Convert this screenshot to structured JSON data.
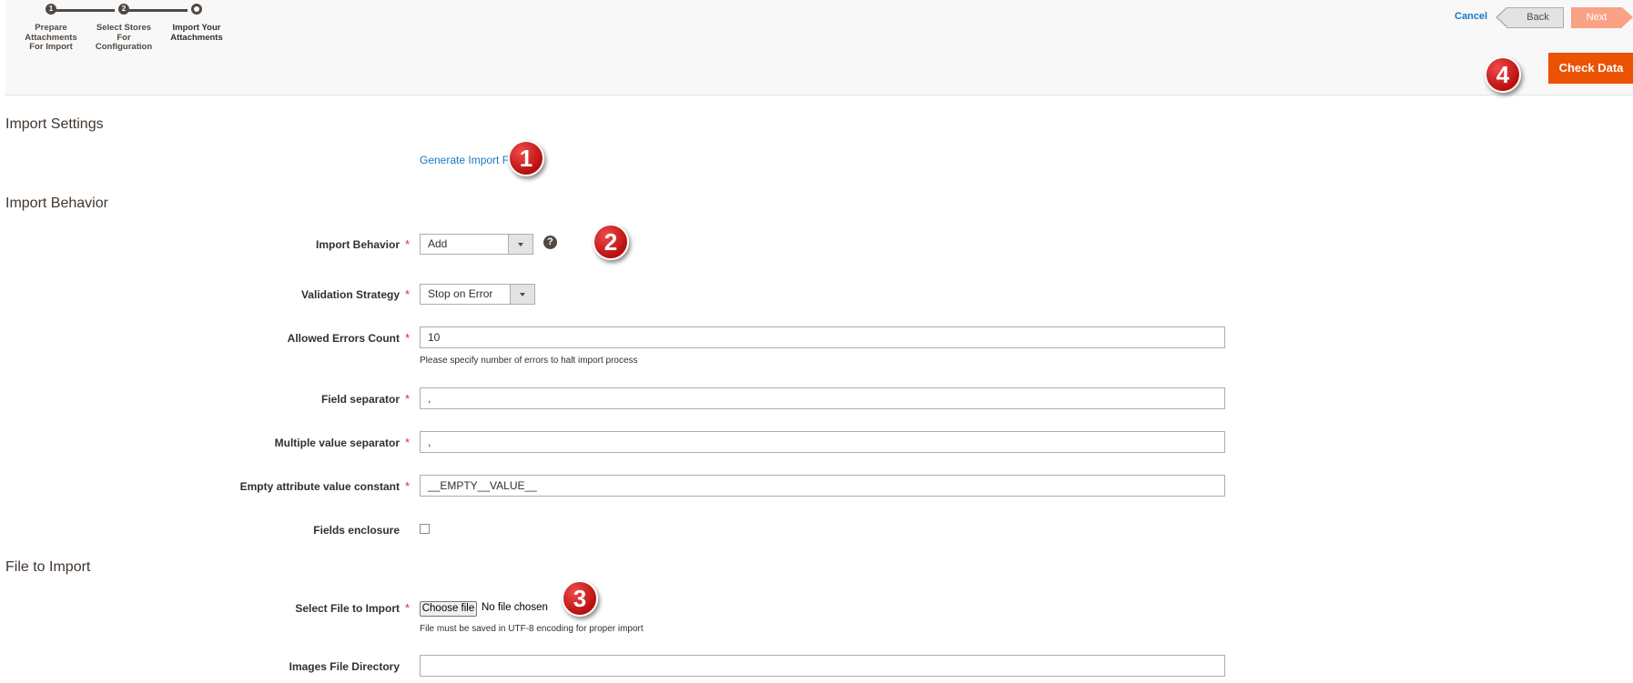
{
  "wizard": {
    "steps": [
      {
        "number": "1",
        "label_lines": [
          "Prepare",
          "Attachments",
          "For Import"
        ]
      },
      {
        "number": "2",
        "label_lines": [
          "Select Stores",
          "For",
          "Configuration"
        ]
      },
      {
        "number": "",
        "label_lines": [
          "Import Your",
          "Attachments"
        ]
      }
    ],
    "cancel_label": "Cancel",
    "back_label": "Back",
    "next_label": "Next",
    "check_data_label": "Check Data"
  },
  "badges": [
    "1",
    "2",
    "3",
    "4"
  ],
  "sections": {
    "import_settings": "Import Settings",
    "import_behavior": "Import Behavior",
    "file_to_import": "File to Import"
  },
  "generate_link": "Generate Import File",
  "form": {
    "import_behavior": {
      "label": "Import Behavior",
      "value": "Add"
    },
    "validation_strategy": {
      "label": "Validation Strategy",
      "value": "Stop on Error"
    },
    "allowed_errors": {
      "label": "Allowed Errors Count",
      "value": "10",
      "note": "Please specify number of errors to halt import process"
    },
    "field_separator": {
      "label": "Field separator",
      "value": ","
    },
    "multiple_value_separator": {
      "label": "Multiple value separator",
      "value": ","
    },
    "empty_attribute": {
      "label": "Empty attribute value constant",
      "value": "__EMPTY__VALUE__"
    },
    "fields_enclosure": {
      "label": "Fields enclosure"
    },
    "select_file": {
      "label": "Select File to Import",
      "button": "Choose file",
      "status": "No file chosen",
      "note": "File must be saved in UTF-8 encoding for proper import"
    },
    "images_dir": {
      "label": "Images File Directory",
      "value": ""
    }
  },
  "required_mark": "*",
  "help_glyph": "?",
  "colors": {
    "accent": "#eb5202",
    "link": "#1979c3",
    "required": "#e22626",
    "badge": "#c41a1a"
  }
}
